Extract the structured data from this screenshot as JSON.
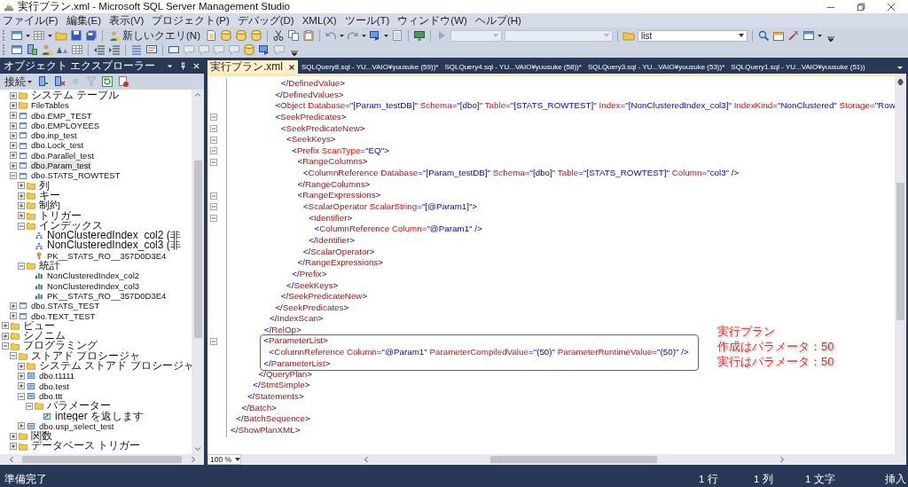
{
  "window": {
    "title": "実行プラン.xml - Microsoft SQL Server Management Studio"
  },
  "menu": [
    "ファイル(F)",
    "編集(E)",
    "表示(V)",
    "プロジェクト(P)",
    "デバッグ(D)",
    "XML(X)",
    "ツール(T)",
    "ウィンドウ(W)",
    "ヘルプ(H)"
  ],
  "toolbar": {
    "new_query": "新しいクエリ(N)",
    "combos": [
      {
        "disabled": true
      },
      {
        "disabled": true
      },
      {
        "value": "list",
        "disabled": false
      }
    ]
  },
  "object_explorer": {
    "title": "オブジェクト エクスプローラー",
    "connect": "接続",
    "tree": [
      {
        "children": [
          {
            "label": "システム テーブル",
            "kind": "folder",
            "expanded": false,
            "selected": false
          },
          {
            "label": "FileTables",
            "kind": "folder",
            "expanded": false,
            "selected": false
          },
          {
            "label": "dbo.EMP_TEST",
            "kind": "table",
            "expanded": false,
            "selected": false
          },
          {
            "label": "dbo.EMPLOYEES",
            "kind": "table",
            "expanded": false,
            "selected": false
          },
          {
            "label": "dbo.inp_test",
            "kind": "table",
            "expanded": false,
            "selected": false
          },
          {
            "label": "dbo.Lock_test",
            "kind": "table",
            "expanded": false,
            "selected": false
          },
          {
            "label": "dbo.Parallel_test",
            "kind": "table",
            "expanded": false,
            "selected": false
          },
          {
            "label": "dbo.Param_test",
            "kind": "table",
            "expanded": false,
            "selected": true
          },
          {
            "label": "dbo.STATS_ROWTEST",
            "kind": "table",
            "expanded": true,
            "selected": false,
            "children": [
              {
                "label": "列",
                "kind": "folder",
                "expanded": false,
                "selected": false
              },
              {
                "label": "キー",
                "kind": "folder",
                "expanded": false,
                "selected": false
              },
              {
                "label": "制約",
                "kind": "folder",
                "expanded": false,
                "selected": false
              },
              {
                "label": "トリガー",
                "kind": "folder",
                "expanded": false,
                "selected": false
              },
              {
                "label": "インデックス",
                "kind": "folder",
                "expanded": true,
                "selected": false,
                "children": [
                  {
                    "label": "NonClusteredIndex_col2 (非",
                    "kind": "index",
                    "selected": false
                  },
                  {
                    "label": "NonClusteredIndex_col3 (非",
                    "kind": "index",
                    "selected": false
                  },
                  {
                    "label": "PK__STATS_RO__357D0D3E4",
                    "kind": "key",
                    "selected": false
                  }
                ]
              },
              {
                "label": "統計",
                "kind": "folder",
                "expanded": true,
                "selected": false,
                "children": [
                  {
                    "label": "NonClusteredIndex_col2",
                    "kind": "statistic",
                    "selected": false
                  },
                  {
                    "label": "NonClusteredIndex_col3",
                    "kind": "statistic",
                    "selected": false
                  },
                  {
                    "label": "PK__STATS_RO__357D0D3E4",
                    "kind": "statistic",
                    "selected": false
                  }
                ]
              }
            ]
          },
          {
            "label": "dbo.STATS_TEST",
            "kind": "table",
            "expanded": false,
            "selected": false
          },
          {
            "label": "dbo.TEXT_TEST",
            "kind": "table",
            "expanded": false,
            "selected": false
          }
        ]
      },
      {
        "label": "ビュー",
        "kind": "folder",
        "expanded": false,
        "selected": false
      },
      {
        "label": "シノニム",
        "kind": "folder",
        "expanded": false,
        "selected": false
      },
      {
        "label": "プログラミング",
        "kind": "folder",
        "expanded": true,
        "selected": false,
        "children": [
          {
            "label": "ストアド プロシージャ",
            "kind": "folder",
            "expanded": true,
            "selected": false,
            "children": [
              {
                "label": "システム ストアド プロシージャ",
                "kind": "folder",
                "expanded": false,
                "selected": false
              },
              {
                "label": "dbo.t1111",
                "kind": "procedure",
                "expanded": false,
                "selected": false
              },
              {
                "label": "dbo.test",
                "kind": "procedure",
                "expanded": false,
                "selected": false
              },
              {
                "label": "dbo.ttt",
                "kind": "procedure",
                "expanded": true,
                "selected": false,
                "children": [
                  {
                    "label": "パラメーター",
                    "kind": "folder",
                    "expanded": true,
                    "selected": false,
                    "children": [
                      {
                        "label": "integer を返します",
                        "kind": "return",
                        "selected": false
                      }
                    ]
                  }
                ]
              },
              {
                "label": "dbo.usp_select_test",
                "kind": "procedure",
                "expanded": false,
                "selected": false
              }
            ]
          },
          {
            "label": "関数",
            "kind": "folder",
            "expanded": false,
            "selected": false
          },
          {
            "label": "データベース トリガー",
            "kind": "folder",
            "expanded": false,
            "selected": false
          }
        ]
      }
    ]
  },
  "tabs": [
    {
      "label": "実行プラン.xml",
      "selected": true
    },
    {
      "label": "SQLQuery8.sql - YU...VAIO¥yuusuke (59))*",
      "selected": false
    },
    {
      "label": "SQLQuery4.sql - YU...VAIO¥yuusuke (58))*",
      "selected": false
    },
    {
      "label": "SQLQuery3.sql - YU...VAIO¥yuusuke (53))*",
      "selected": false
    },
    {
      "label": "SQLQuery1.sql - YU...VAIO¥yuusuke (51))",
      "selected": false
    }
  ],
  "editor": {
    "lines": [
      {
        "close": "</ShowPlanXML>",
        "children": [
          {
            "close": "</BatchSequence>",
            "children": [
              {
                "close": "</Batch>",
                "children": [
                  {
                    "close": "</Statements>",
                    "children": [
                      {
                        "close": "</StmtSimple>",
                        "children": [
                          {
                            "close": "</QueryPlan>",
                            "children": [
                              {
                                "close": "</RelOp>",
                                "children": [
                                  {
                                    "close": "</IndexScan>",
                                    "children": [
                                      {
                                        "close": "</DefinedValues>",
                                        "children": [
                                          {
                                            "close": "</DefinedValue>"
                                          }
                                        ]
                                      },
                                      {
                                        "line": "<Object Database=\"[Param_testDB]\" Schema=\"[dbo]\" Table=\"[STATS_ROWTEST]\" Index=\"[NonClusteredIndex_col3]\" IndexKind=\"NonClustered\" Storage=\"Row"
                                      },
                                      {
                                        "open": "<SeekPredicates>",
                                        "close": "</SeekPredicates>",
                                        "children": [
                                          {
                                            "open": "<SeekPredicateNew>",
                                            "close": "</SeekPredicateNew>",
                                            "children": [
                                              {
                                                "open": "<SeekKeys>",
                                                "close": "</SeekKeys>",
                                                "children": [
                                                  {
                                                    "open": "<Prefix ScanType=\"EQ\">",
                                                    "close": "</Prefix>",
                                                    "children": [
                                                      {
                                                        "open": "<RangeColumns>",
                                                        "close": "</RangeColumns>",
                                                        "children": [
                                                          {
                                                            "line": "<ColumnReference Database=\"[Param_testDB]\" Schema=\"[dbo]\" Table=\"[STATS_ROWTEST]\" Column=\"col3\" />"
                                                          }
                                                        ]
                                                      },
                                                      {
                                                        "open": "<RangeExpressions>",
                                                        "close": "</RangeExpressions>",
                                                        "children": [
                                                          {
                                                            "open": "<ScalarOperator ScalarString=\"[@Param1]\">",
                                                            "close": "</ScalarOperator>",
                                                            "children": [
                                                              {
                                                                "open": "<Identifier>",
                                                                "close": "</Identifier>",
                                                                "children": [
                                                                  {
                                                                    "line": "<ColumnReference Column=\"@Param1\" />"
                                                                  }
                                                                ]
                                                              }
                                                            ]
                                                          }
                                                        ]
                                                      }
                                                    ]
                                                  }
                                                ]
                                              }
                                            ]
                                          }
                                        ]
                                      }
                                    ]
                                  }
                                ]
                              },
                              {
                                "open": "<ParameterList>",
                                "close": "</ParameterList>",
                                "highlighted": true,
                                "children": [
                                  {
                                    "line": "<ColumnReference Column=\"@Param1\" ParameterCompiledValue=\"(50)\" ParameterRuntimeValue=\"(50)\" />"
                                  }
                                ]
                              }
                            ]
                          }
                        ]
                      }
                    ]
                  }
                ]
              }
            ]
          }
        ]
      }
    ],
    "annotation": [
      "実行プラン",
      "作成はパラメータ：50",
      "実行はパラメータ：50"
    ],
    "zoom": "100 %"
  },
  "status_bar": {
    "message": "準備完了",
    "line": "1 行",
    "column": "1 列",
    "char": "1 文字",
    "mode": "挿入"
  }
}
